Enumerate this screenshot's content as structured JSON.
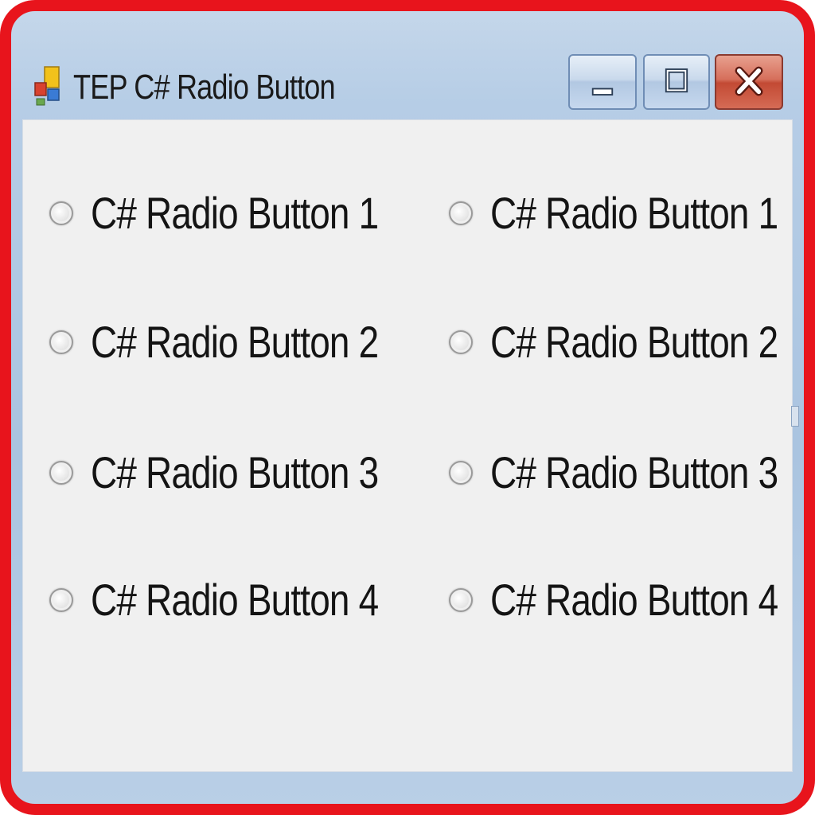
{
  "window": {
    "title": "TEP C# Radio Button",
    "icon": "app-form-icon"
  },
  "caption_buttons": {
    "minimize_icon": "minimize-icon",
    "maximize_icon": "maximize-icon",
    "close_icon": "close-icon"
  },
  "radio_groups": [
    {
      "items": [
        {
          "label": "C# Radio Button 1",
          "checked": false
        },
        {
          "label": "C# Radio Button 2",
          "checked": false
        },
        {
          "label": "C# Radio Button 3",
          "checked": false
        },
        {
          "label": "C# Radio Button 4",
          "checked": false
        }
      ]
    },
    {
      "items": [
        {
          "label": "C# Radio Button 1",
          "checked": false
        },
        {
          "label": "C# Radio Button 2",
          "checked": false
        },
        {
          "label": "C# Radio Button 3",
          "checked": false
        },
        {
          "label": "C# Radio Button 4",
          "checked": false
        }
      ]
    }
  ],
  "colors": {
    "highlight_frame": "#e8141c",
    "client_background": "#f0f0f0",
    "close_button": "#c34a34"
  }
}
